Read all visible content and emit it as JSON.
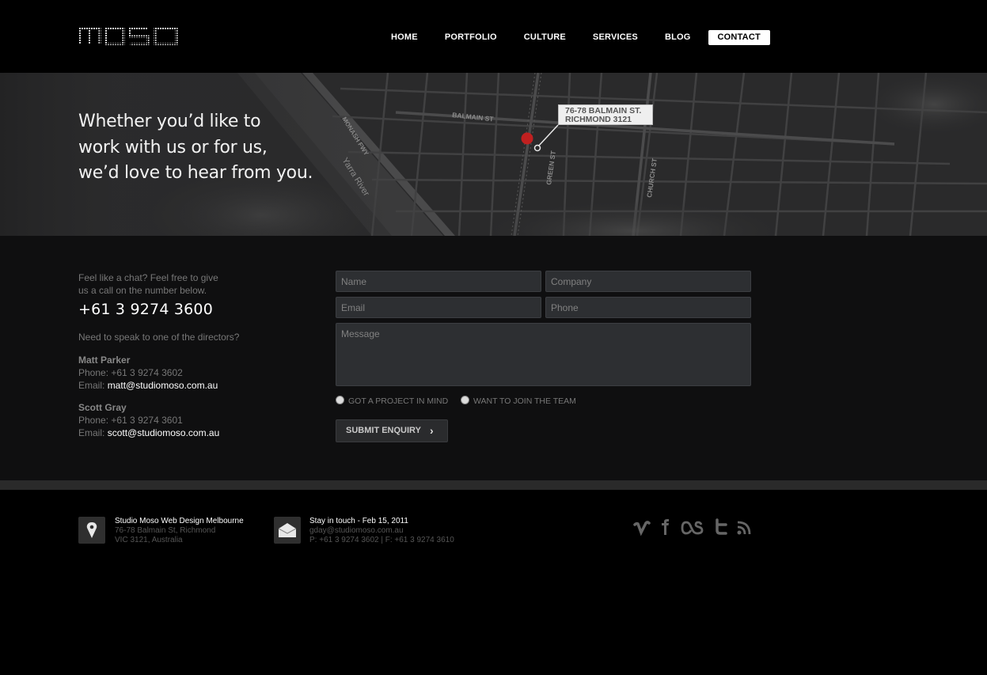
{
  "header": {
    "logo_alt": "moso",
    "nav": [
      {
        "label": "HOME"
      },
      {
        "label": "PORTFOLIO"
      },
      {
        "label": "CULTURE"
      },
      {
        "label": "SERVICES"
      },
      {
        "label": "BLOG"
      },
      {
        "label": "CONTACT",
        "active": true
      }
    ]
  },
  "hero": {
    "tagline": [
      "Whether you’d like to",
      "work with us or for us,",
      "we’d love to hear from you."
    ],
    "map_labels": {
      "monash": "MONASH FWY",
      "yarra": "Yarra River",
      "balmain": "BALMAIN ST",
      "green": "GREEN ST",
      "church": "CHURCH ST"
    },
    "callout": [
      "76-78 BALMAIN ST.",
      "RICHMOND 3121"
    ]
  },
  "contact": {
    "intro": [
      "Feel like a chat? Feel free to give",
      "us a call on the number below."
    ],
    "phone": "+61 3 9274 3600",
    "directors_q": "Need to speak to one of the directors?",
    "directors": [
      {
        "name": "Matt Parker",
        "phone": "Phone: +61 3 9274 3602",
        "email_label": "Email:",
        "email": "matt@studiomoso.com.au"
      },
      {
        "name": "Scott Gray",
        "phone": "Phone: +61 3 9274 3601",
        "email_label": "Email:",
        "email": "scott@studiomoso.com.au"
      }
    ]
  },
  "form": {
    "name_placeholder": "Name",
    "company_placeholder": "Company",
    "email_placeholder": "Email",
    "phone_placeholder": "Phone",
    "message_placeholder": "Message",
    "radio1": "GOT A PROJECT IN MIND",
    "radio2": "WANT TO JOIN THE TEAM",
    "submit": "SUBMIT ENQUIRY"
  },
  "footer": {
    "address": {
      "title": "Studio Moso Web Design Melbourne",
      "line1": "76-78 Balmain St, Richmond",
      "line2": "VIC 3121, Australia"
    },
    "stay": {
      "title": "Stay in touch - Feb 15, 2011",
      "email": "gday@studiomoso.com.au",
      "phones": "P: +61 3 9274 3602 | F: +61 3 9274 3610"
    },
    "social_icons": [
      "vimeo-icon",
      "facebook-icon",
      "lastfm-icon",
      "twitter-icon",
      "rss-icon"
    ]
  }
}
